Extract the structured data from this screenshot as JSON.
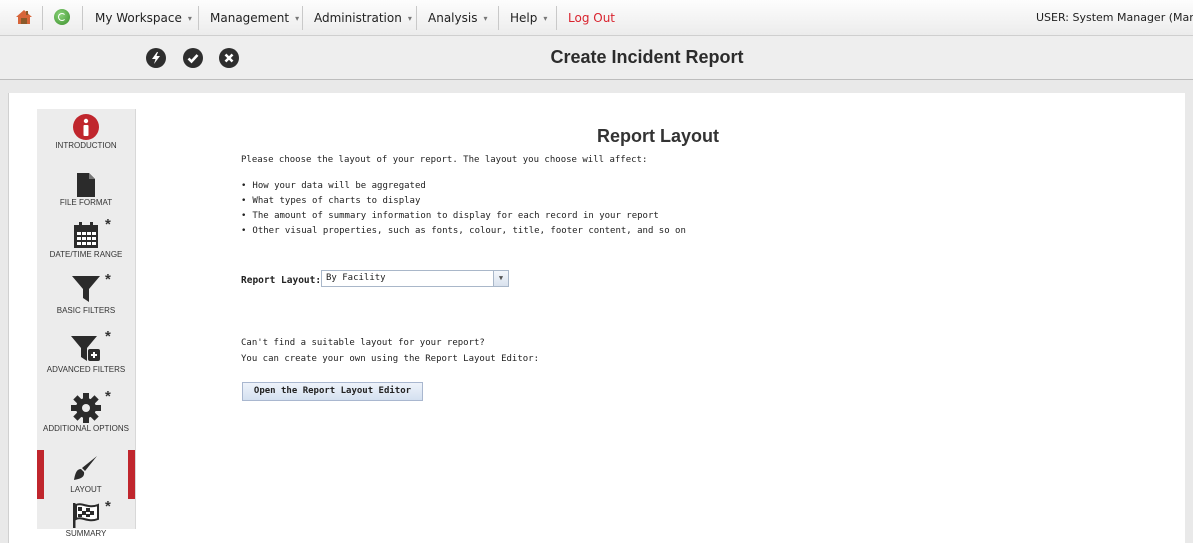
{
  "menubar": {
    "items": [
      {
        "label": "My Workspace",
        "caret": "▾"
      },
      {
        "label": "Management",
        "caret": "▾"
      },
      {
        "label": "Administration",
        "caret": "▾"
      },
      {
        "label": "Analysis",
        "caret": "▾"
      },
      {
        "label": "Help",
        "caret": "▾"
      }
    ],
    "logout": "Log Out",
    "user": "USER: System Manager (Manager"
  },
  "titlebar": {
    "title": "Create Incident Report",
    "icons": [
      "bolt-icon",
      "check-icon",
      "close-icon"
    ]
  },
  "wizard": {
    "steps": [
      {
        "label": "INTRODUCTION",
        "required": false
      },
      {
        "label": "FILE FORMAT",
        "required": false
      },
      {
        "label": "DATE/TIME RANGE",
        "required": true
      },
      {
        "label": "BASIC FILTERS",
        "required": true
      },
      {
        "label": "ADVANCED FILTERS",
        "required": true
      },
      {
        "label": "ADDITIONAL OPTIONS",
        "required": true
      },
      {
        "label": "LAYOUT",
        "required": false,
        "active": true
      },
      {
        "label": "SUMMARY",
        "required": true
      }
    ],
    "star": "*",
    "info_glyph": "i"
  },
  "main": {
    "heading": "Report Layout",
    "intro": "Please choose the layout of your report. The layout you choose will affect:",
    "bullets": [
      "How your data will be aggregated",
      "What types of charts to display",
      "The amount of summary information to display for each record in your report",
      "Other visual properties, such as fonts, colour, title, footer content, and so on"
    ],
    "layout_label": "Report Layout:",
    "layout_value": "By Facility",
    "help_line1": "Can't find a suitable layout for your report?",
    "help_line2": "You can create your own using the Report Layout Editor:",
    "editor_button": "Open the Report Layout Editor"
  },
  "colors": {
    "active_step": "#c0262d",
    "logout": "#d9232e",
    "button_bg": "#dbe5f2"
  }
}
